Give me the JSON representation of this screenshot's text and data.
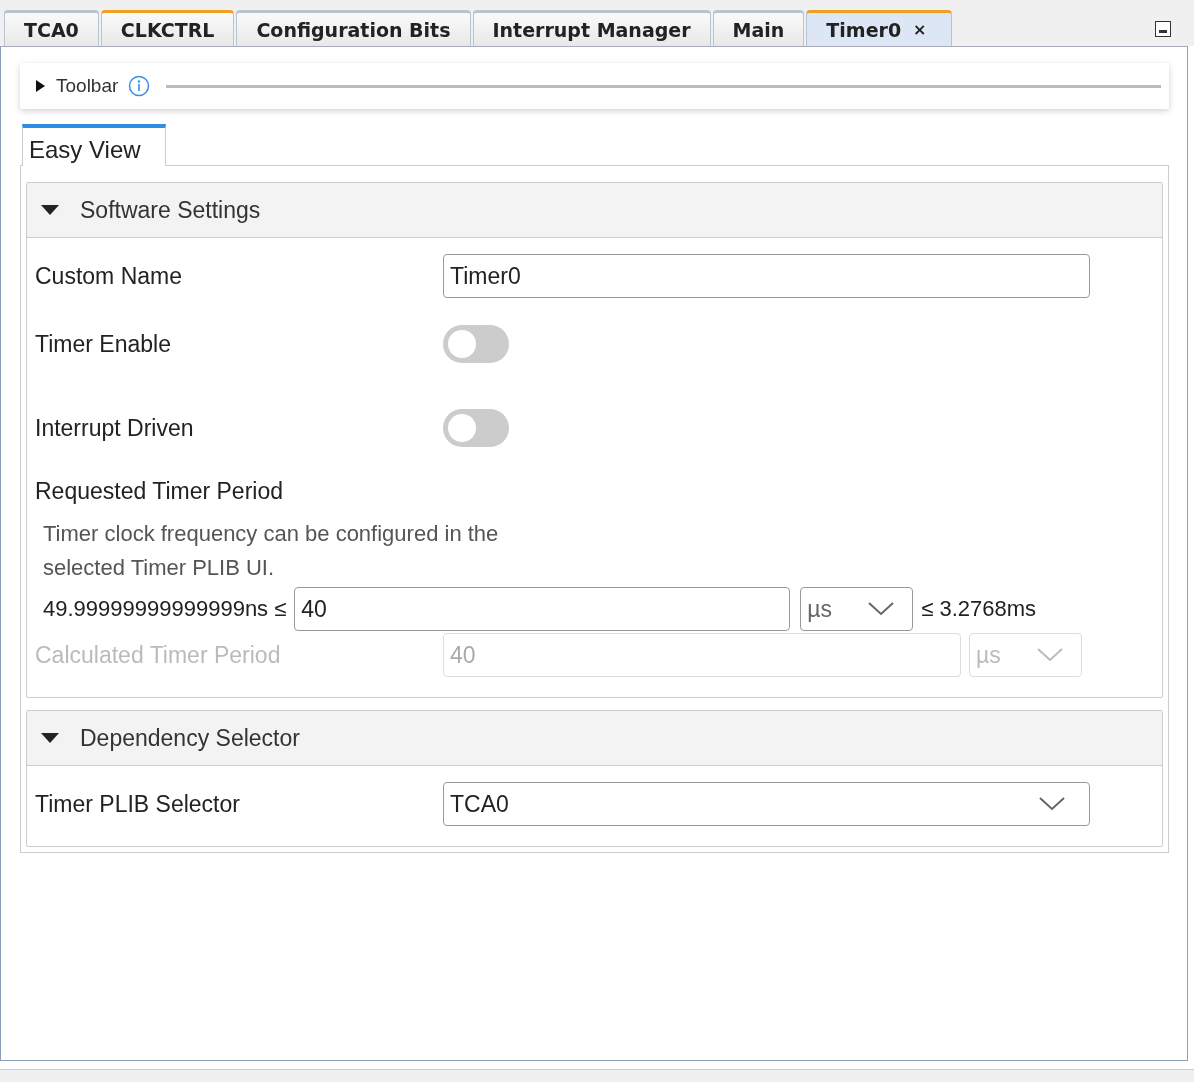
{
  "tabs": [
    {
      "label": "TCA0",
      "selected": false,
      "modified": false,
      "closable": false
    },
    {
      "label": "CLKCTRL",
      "selected": false,
      "modified": true,
      "closable": false
    },
    {
      "label": "Configuration Bits",
      "selected": false,
      "modified": false,
      "closable": false
    },
    {
      "label": "Interrupt Manager",
      "selected": false,
      "modified": false,
      "closable": false
    },
    {
      "label": "Main",
      "selected": false,
      "modified": false,
      "closable": false
    },
    {
      "label": "Timer0",
      "selected": true,
      "modified": true,
      "closable": true,
      "close": "×"
    }
  ],
  "toolbar": {
    "label": "Toolbar",
    "expanded": false
  },
  "view_tabs": [
    {
      "label": "Easy View",
      "selected": true
    }
  ],
  "sections": [
    {
      "title": "Software Settings",
      "expanded": true,
      "rows": [
        {
          "kind": "text",
          "label": "Custom Name",
          "value": "Timer0",
          "disabled": false
        },
        {
          "kind": "toggle",
          "label": "Timer Enable",
          "on": false
        },
        {
          "kind": "toggle",
          "label": "Interrupt Driven",
          "on": false
        },
        {
          "kind": "range",
          "label": "Requested Timer Period",
          "note": "Timer clock frequency can be configured in the selected Timer PLIB UI.",
          "min": "49.99999999999999ns ≤",
          "value": "40",
          "unit": "µs",
          "max": "≤ 3.2768ms",
          "disabled": false
        },
        {
          "kind": "unit",
          "label": "Calculated Timer Period",
          "value": "40",
          "unit": "µs",
          "disabled": true
        }
      ]
    },
    {
      "title": "Dependency Selector",
      "expanded": true,
      "rows": [
        {
          "kind": "select",
          "label": "Timer PLIB Selector",
          "value": "TCA0",
          "disabled": false
        }
      ]
    }
  ]
}
